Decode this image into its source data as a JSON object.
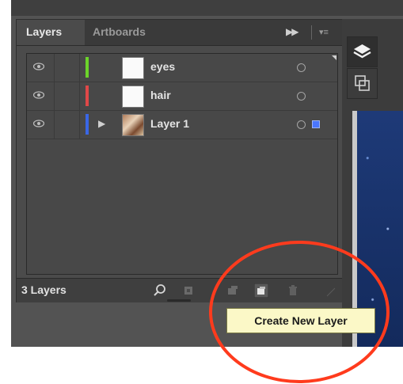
{
  "panel": {
    "tabs": [
      {
        "label": "Layers"
      },
      {
        "label": "Artboards"
      }
    ],
    "flyout_menu_icon": "double-chevron-right-icon"
  },
  "layers": [
    {
      "name": "eyes",
      "color": "#6cd42a",
      "thumbnail": "white",
      "expandable": false,
      "selected": false
    },
    {
      "name": "hair",
      "color": "#e04848",
      "thumbnail": "white",
      "expandable": false,
      "selected": false
    },
    {
      "name": "Layer 1",
      "color": "#3a67e6",
      "thumbnail": "photo",
      "expandable": true,
      "selected": true
    }
  ],
  "footer": {
    "count_label": "3 Layers",
    "icons": [
      "locate-object-icon",
      "make-clipping-mask-icon",
      "create-sublayer-icon",
      "create-new-layer-icon",
      "delete-icon"
    ]
  },
  "dock": {
    "icons": [
      "layers-icon",
      "artboards-icon"
    ]
  },
  "tooltip": {
    "text": "Create New Layer"
  },
  "colors": {
    "accent_annotation": "#ff3b1d",
    "selection_blue": "#4a76ff"
  }
}
